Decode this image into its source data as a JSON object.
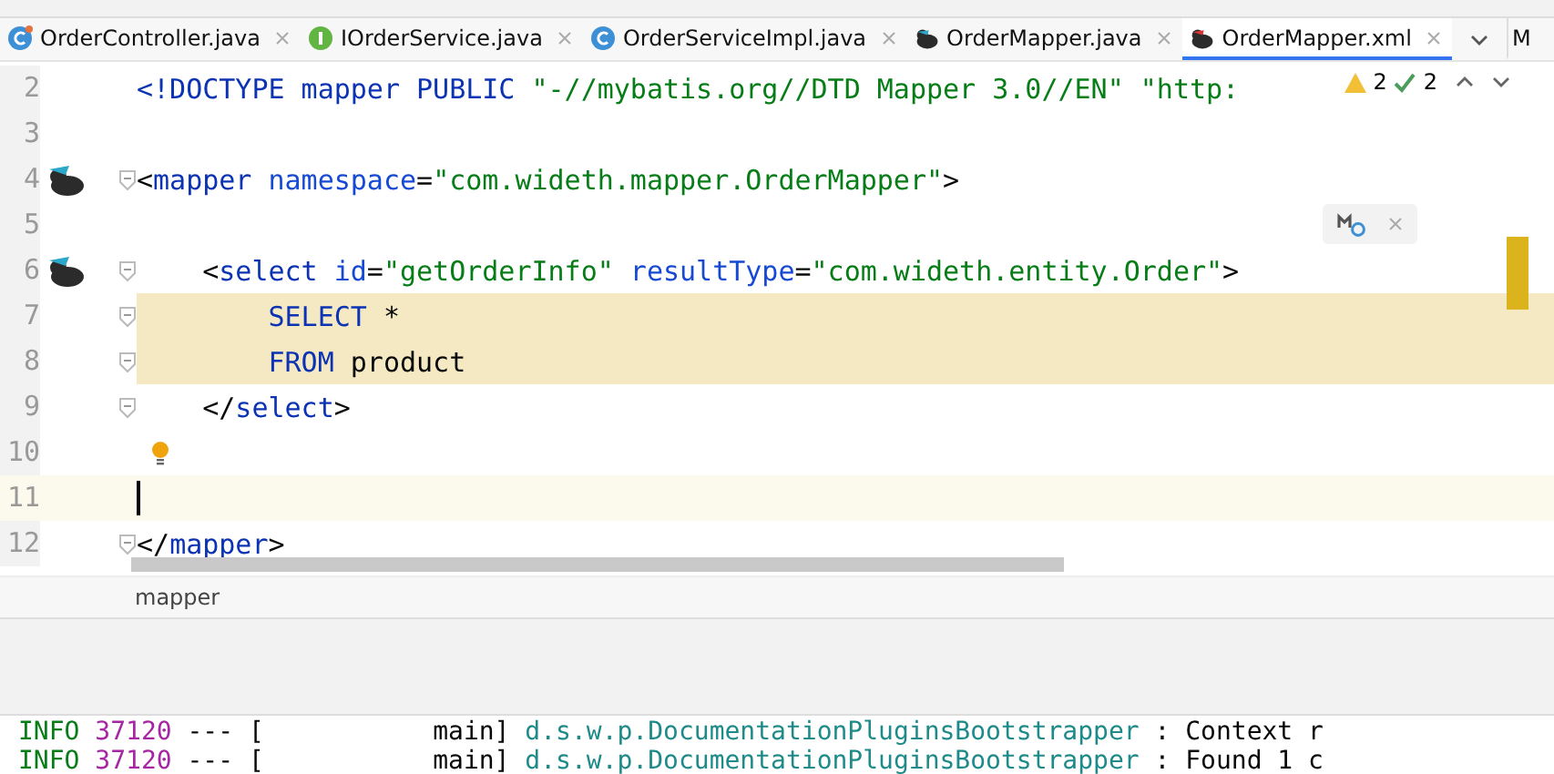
{
  "tabs": [
    {
      "label": "OrderController.java",
      "kind": "runnable",
      "selected": false
    },
    {
      "label": "IOrderService.java",
      "kind": "interface",
      "selected": false
    },
    {
      "label": "OrderServiceImpl.java",
      "kind": "class",
      "selected": false
    },
    {
      "label": "OrderMapper.java",
      "kind": "mapper",
      "selected": false
    },
    {
      "label": "OrderMapper.xml",
      "kind": "xml",
      "selected": true
    }
  ],
  "next_tab_label": "M",
  "inspections": {
    "warnings": "2",
    "weak_warnings": "2"
  },
  "lines": [
    {
      "number": "2",
      "tokens": [
        {
          "t": "<!DOCTYPE mapper PUBLIC ",
          "kind": "tag"
        },
        {
          "t": "\"-//mybatis.org//DTD Mapper 3.0//EN\" \"http:",
          "kind": "string"
        }
      ],
      "fold": false,
      "highlighted": false,
      "current": false
    },
    {
      "number": "3",
      "fold": false,
      "highlighted": false,
      "current": false
    },
    {
      "number": "4",
      "kind": "mapper",
      "tokens": [
        {
          "t": "<",
          "kind": "text"
        },
        {
          "t": "mapper ",
          "kind": "tag"
        },
        {
          "t": "namespace",
          "kind": "attr"
        },
        {
          "t": "=",
          "kind": "text"
        },
        {
          "t": "\"com.wideth.mapper.OrderMapper\"",
          "kind": "string"
        },
        {
          "t": ">",
          "kind": "text"
        }
      ],
      "fold": true,
      "highlighted": false,
      "current": false,
      "children": [
        {
          "number": "5",
          "fold": false,
          "highlighted": false,
          "current": false
        },
        {
          "number": "6",
          "kind": "mapper",
          "tokens": [
            {
              "t": "<",
              "kind": "text"
            },
            {
              "t": "select ",
              "kind": "tag"
            },
            {
              "t": "id",
              "kind": "attr"
            },
            {
              "t": "=",
              "kind": "text"
            },
            {
              "t": "\"getOrderInfo\" ",
              "kind": "string"
            },
            {
              "t": "resultType",
              "kind": "attr"
            },
            {
              "t": "=",
              "kind": "text"
            },
            {
              "t": "\"com.wideth.entity.Order\"",
              "kind": "string"
            },
            {
              "t": ">",
              "kind": "text"
            }
          ],
          "fold": true,
          "highlighted": false,
          "current": false,
          "children": [
            {
              "number": "7",
              "tokens": [
                {
                  "t": "SELECT ",
                  "kind": "keyword"
                },
                {
                  "t": "*",
                  "kind": "text"
                }
              ],
              "fold": true,
              "highlighted": true,
              "current": false
            },
            {
              "number": "8",
              "tokens": [
                {
                  "t": "FROM ",
                  "kind": "keyword"
                },
                {
                  "t": "product",
                  "kind": "text"
                }
              ],
              "fold": true,
              "highlighted": true,
              "current": false
            }
          ]
        },
        {
          "number": "9",
          "tokens": [
            {
              "t": "</",
              "kind": "text"
            },
            {
              "t": "select",
              "kind": "tag"
            },
            {
              "t": ">",
              "kind": "text"
            }
          ],
          "fold": true,
          "highlighted": false,
          "current": false
        },
        {
          "number": "10",
          "kind": "bulb",
          "fold": false,
          "highlighted": false,
          "current": false
        },
        {
          "number": "11",
          "fold": false,
          "highlighted": false,
          "current": true
        }
      ]
    },
    {
      "number": "12",
      "tokens": [
        {
          "t": "</",
          "kind": "text"
        },
        {
          "t": "mapper",
          "kind": "tag"
        },
        {
          "t": ">",
          "kind": "text"
        }
      ],
      "fold": true,
      "highlighted": false,
      "current": false
    }
  ],
  "breadcrumb": "mapper",
  "console": [
    {
      "tokens": [
        {
          "t": "INFO ",
          "kind": "level"
        },
        {
          "t": "37120 ",
          "kind": "pid"
        },
        {
          "t": "--- [           main] ",
          "kind": "text"
        },
        {
          "t": "d.s.w.p.DocumentationPluginsBootstrapper",
          "kind": "logger"
        },
        {
          "t": " : Context r",
          "kind": "text"
        }
      ]
    },
    {
      "tokens": [
        {
          "t": "INFO ",
          "kind": "level"
        },
        {
          "t": "37120 ",
          "kind": "pid"
        },
        {
          "t": "--- [           main] ",
          "kind": "text"
        },
        {
          "t": "d.s.w.p.DocumentationPluginsBootstrapper",
          "kind": "logger"
        },
        {
          "t": " : Found 1 c",
          "kind": "text"
        }
      ]
    }
  ]
}
